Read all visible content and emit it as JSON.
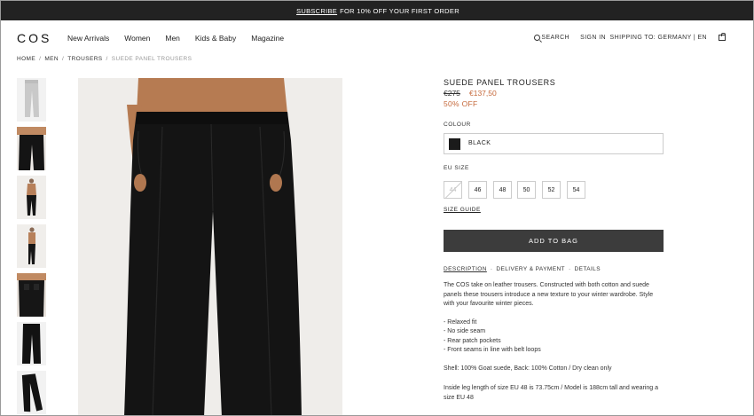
{
  "promo": {
    "link": "SUBSCRIBE",
    "text": "FOR 10% OFF YOUR FIRST ORDER"
  },
  "header": {
    "logo": "COS",
    "nav": [
      "New Arrivals",
      "Women",
      "Men",
      "Kids & Baby",
      "Magazine"
    ],
    "search": "SEARCH",
    "signin": "SIGN IN",
    "shipping": "SHIPPING TO: GERMANY | EN"
  },
  "breadcrumb": [
    "HOME",
    "MEN",
    "TROUSERS",
    "SUEDE PANEL TROUSERS"
  ],
  "breadcrumb_sep": "/",
  "product": {
    "title": "SUEDE PANEL TROUSERS",
    "price_old": "€275",
    "price_new": "€137,50",
    "discount": "50% OFF",
    "colour_label": "COLOUR",
    "colour": "BLACK",
    "colour_hex": "#1b1b1b",
    "size_label": "EU SIZE",
    "sizes": [
      "44",
      "46",
      "48",
      "50",
      "52",
      "54"
    ],
    "size_guide": "SIZE GUIDE",
    "add_to_bag": "ADD TO BAG"
  },
  "tabs": {
    "description": "DESCRIPTION",
    "delivery": "DELIVERY & PAYMENT",
    "details": "DETAILS",
    "separator": "·"
  },
  "description": {
    "intro": "The COS take on leather trousers. Constructed with both cotton and suede panels these trousers introduce a new texture to your winter wardrobe. Style with your favourite winter pieces.",
    "bullets": [
      "- Relaxed fit",
      "- No side seam",
      "- Rear patch pockets",
      "- Front seams in line with belt loops"
    ],
    "shell": "Shell: 100% Goat suede, Back: 100% Cotton / Dry clean only",
    "fit": "Inside leg length of size EU 48 is 73.75cm / Model is 188cm tall and wearing a size EU 48"
  },
  "colors": {
    "promo_bg": "#222222",
    "sale": "#c5683a",
    "button_bg": "#3c3c3c"
  }
}
